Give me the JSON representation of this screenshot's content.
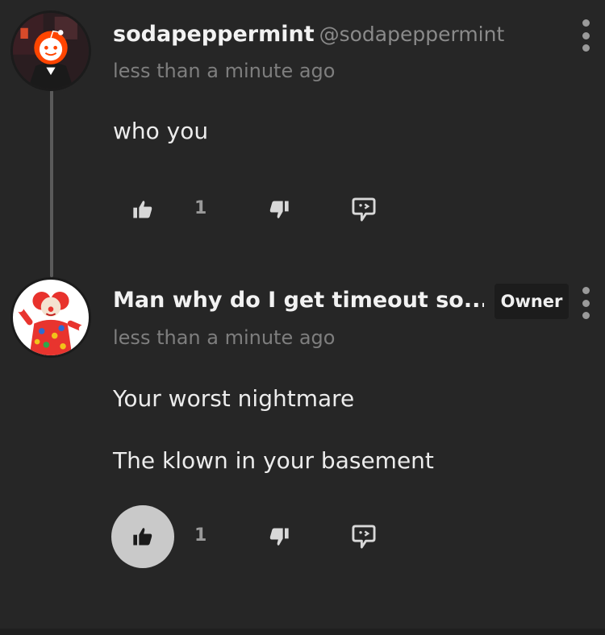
{
  "comments": [
    {
      "author": "sodapeppermint",
      "handle": "@sodapeppermint",
      "time": "less than a minute ago",
      "lines": [
        "who you"
      ],
      "likes": "1",
      "liked": false
    },
    {
      "author": "Man why do I get timeout so...",
      "badge": "Owner",
      "time": "less than a minute ago",
      "lines": [
        "Your worst nightmare",
        "The klown in your basement"
      ],
      "likes": "1",
      "liked": true
    }
  ],
  "colors": {
    "background": "#262626",
    "thread_line": "#5a5a5a",
    "muted_text": "#7e7e7e",
    "liked_circle": "#c9c9c9"
  },
  "icons": [
    "thumbs-up-icon",
    "thumbs-down-icon",
    "reply-icon",
    "more-vertical-icon"
  ]
}
